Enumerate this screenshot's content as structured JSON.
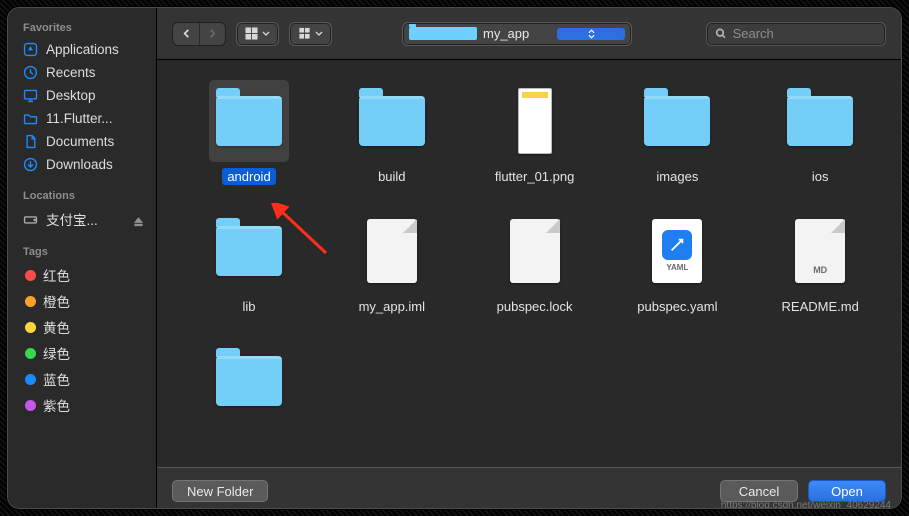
{
  "sidebar": {
    "favorites_header": "Favorites",
    "favorites": [
      {
        "label": "Applications",
        "icon": "app"
      },
      {
        "label": "Recents",
        "icon": "clock"
      },
      {
        "label": "Desktop",
        "icon": "desktop"
      },
      {
        "label": "11.Flutter...",
        "icon": "folder"
      },
      {
        "label": "Documents",
        "icon": "doc"
      },
      {
        "label": "Downloads",
        "icon": "download"
      }
    ],
    "locations_header": "Locations",
    "locations": [
      {
        "label": "支付宝..."
      }
    ],
    "tags_header": "Tags",
    "tags": [
      {
        "label": "红色",
        "color": "#fc4b4a"
      },
      {
        "label": "橙色",
        "color": "#fd9f2b"
      },
      {
        "label": "黄色",
        "color": "#ffd53c"
      },
      {
        "label": "绿色",
        "color": "#39d74a"
      },
      {
        "label": "蓝色",
        "color": "#1a8cff"
      },
      {
        "label": "紫色",
        "color": "#c757e8"
      }
    ]
  },
  "toolbar": {
    "path": "my_app",
    "search_placeholder": "Search"
  },
  "items": [
    {
      "name": "android",
      "type": "folder",
      "selected": true
    },
    {
      "name": "build",
      "type": "folder"
    },
    {
      "name": "flutter_01.png",
      "type": "thumb"
    },
    {
      "name": "images",
      "type": "folder"
    },
    {
      "name": "ios",
      "type": "folder"
    },
    {
      "name": "lib",
      "type": "folder"
    },
    {
      "name": "my_app.iml",
      "type": "file",
      "ext": ""
    },
    {
      "name": "pubspec.lock",
      "type": "file",
      "ext": ""
    },
    {
      "name": "pubspec.yaml",
      "type": "yaml",
      "ext": "YAML"
    },
    {
      "name": "README.md",
      "type": "md",
      "ext": "MD"
    },
    {
      "name": "",
      "type": "folder"
    }
  ],
  "footer": {
    "new_folder": "New Folder",
    "cancel": "Cancel",
    "open": "Open"
  },
  "watermark": "https://blog.csdn.net/weixin_40629244"
}
